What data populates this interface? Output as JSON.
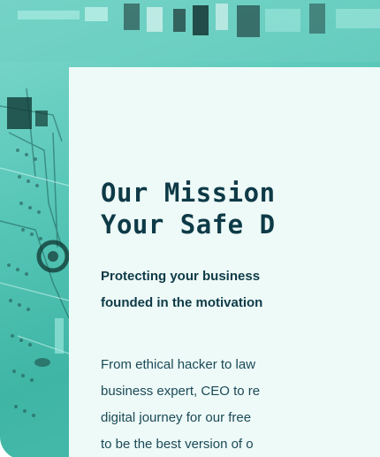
{
  "hero": {
    "image": "circuit-board-teal-overlay"
  },
  "mission": {
    "heading_lines": [
      "Our Mission",
      "Your Safe D"
    ],
    "subheading_lines": [
      "Protecting your business",
      "founded in the motivation"
    ],
    "body_lines": [
      "From ethical hacker to law",
      "business expert, CEO to re",
      "digital journey for our free",
      "to be the best version of o"
    ]
  },
  "colors": {
    "accent": "#4cbcae",
    "card_background": "#eefaf8",
    "heading": "#0e3a47"
  }
}
